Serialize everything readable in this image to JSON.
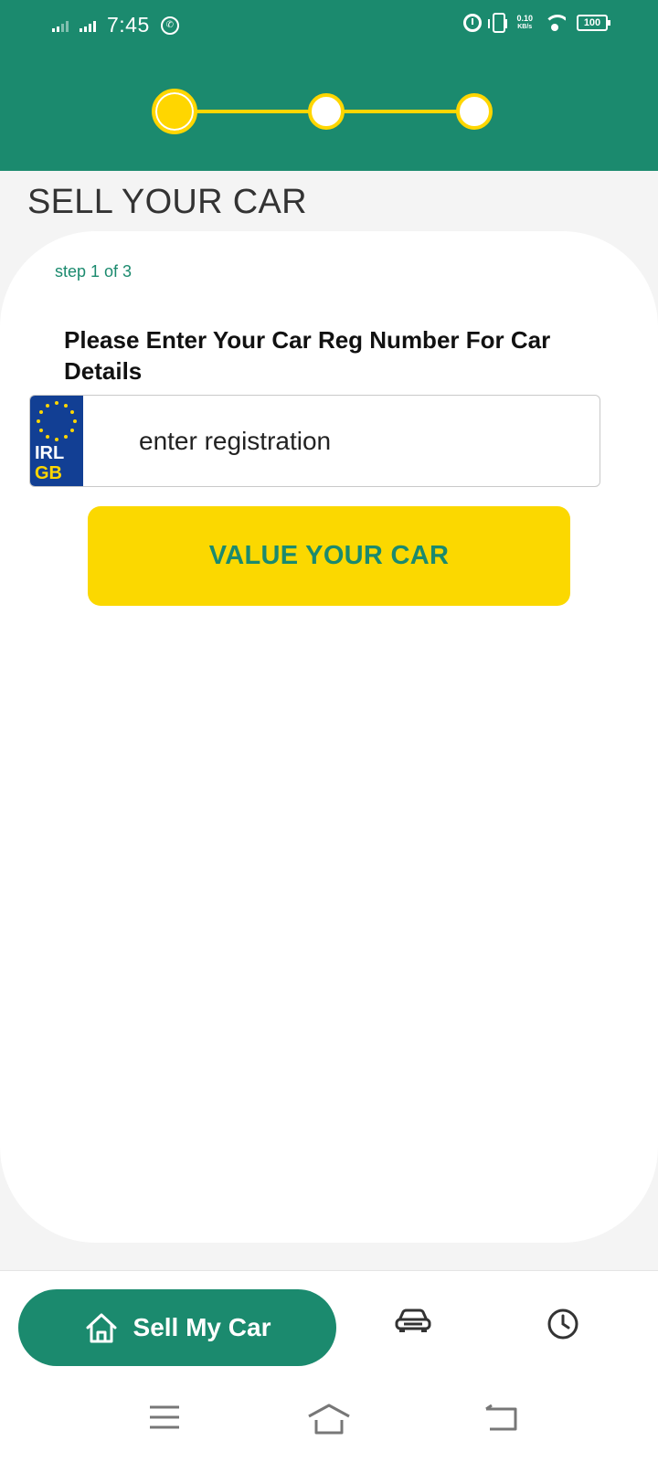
{
  "status_bar": {
    "time": "7:45",
    "net_speed_value": "0.10",
    "net_speed_unit": "KB/s",
    "battery": "100"
  },
  "stepper": {
    "current_step": 1,
    "total_steps": 3
  },
  "page": {
    "title": "SELL YOUR CAR"
  },
  "form": {
    "step_text": "step 1 of 3",
    "instruction": "Please Enter Your Car Reg Number For Car Details",
    "plate_line1": "IRL",
    "plate_line2": "GB",
    "registration_placeholder": "enter registration",
    "registration_value": "",
    "submit_label": "VALUE YOUR CAR"
  },
  "bottom_nav": {
    "active_label": "Sell My Car",
    "items": [
      {
        "icon": "home-icon",
        "label": "Sell My Car",
        "active": true
      },
      {
        "icon": "car-icon",
        "label": "",
        "active": false
      },
      {
        "icon": "clock-icon",
        "label": "",
        "active": false
      }
    ]
  },
  "colors": {
    "primary": "#1b8a6e",
    "accent": "#fbd800",
    "plate_blue": "#123f94"
  }
}
